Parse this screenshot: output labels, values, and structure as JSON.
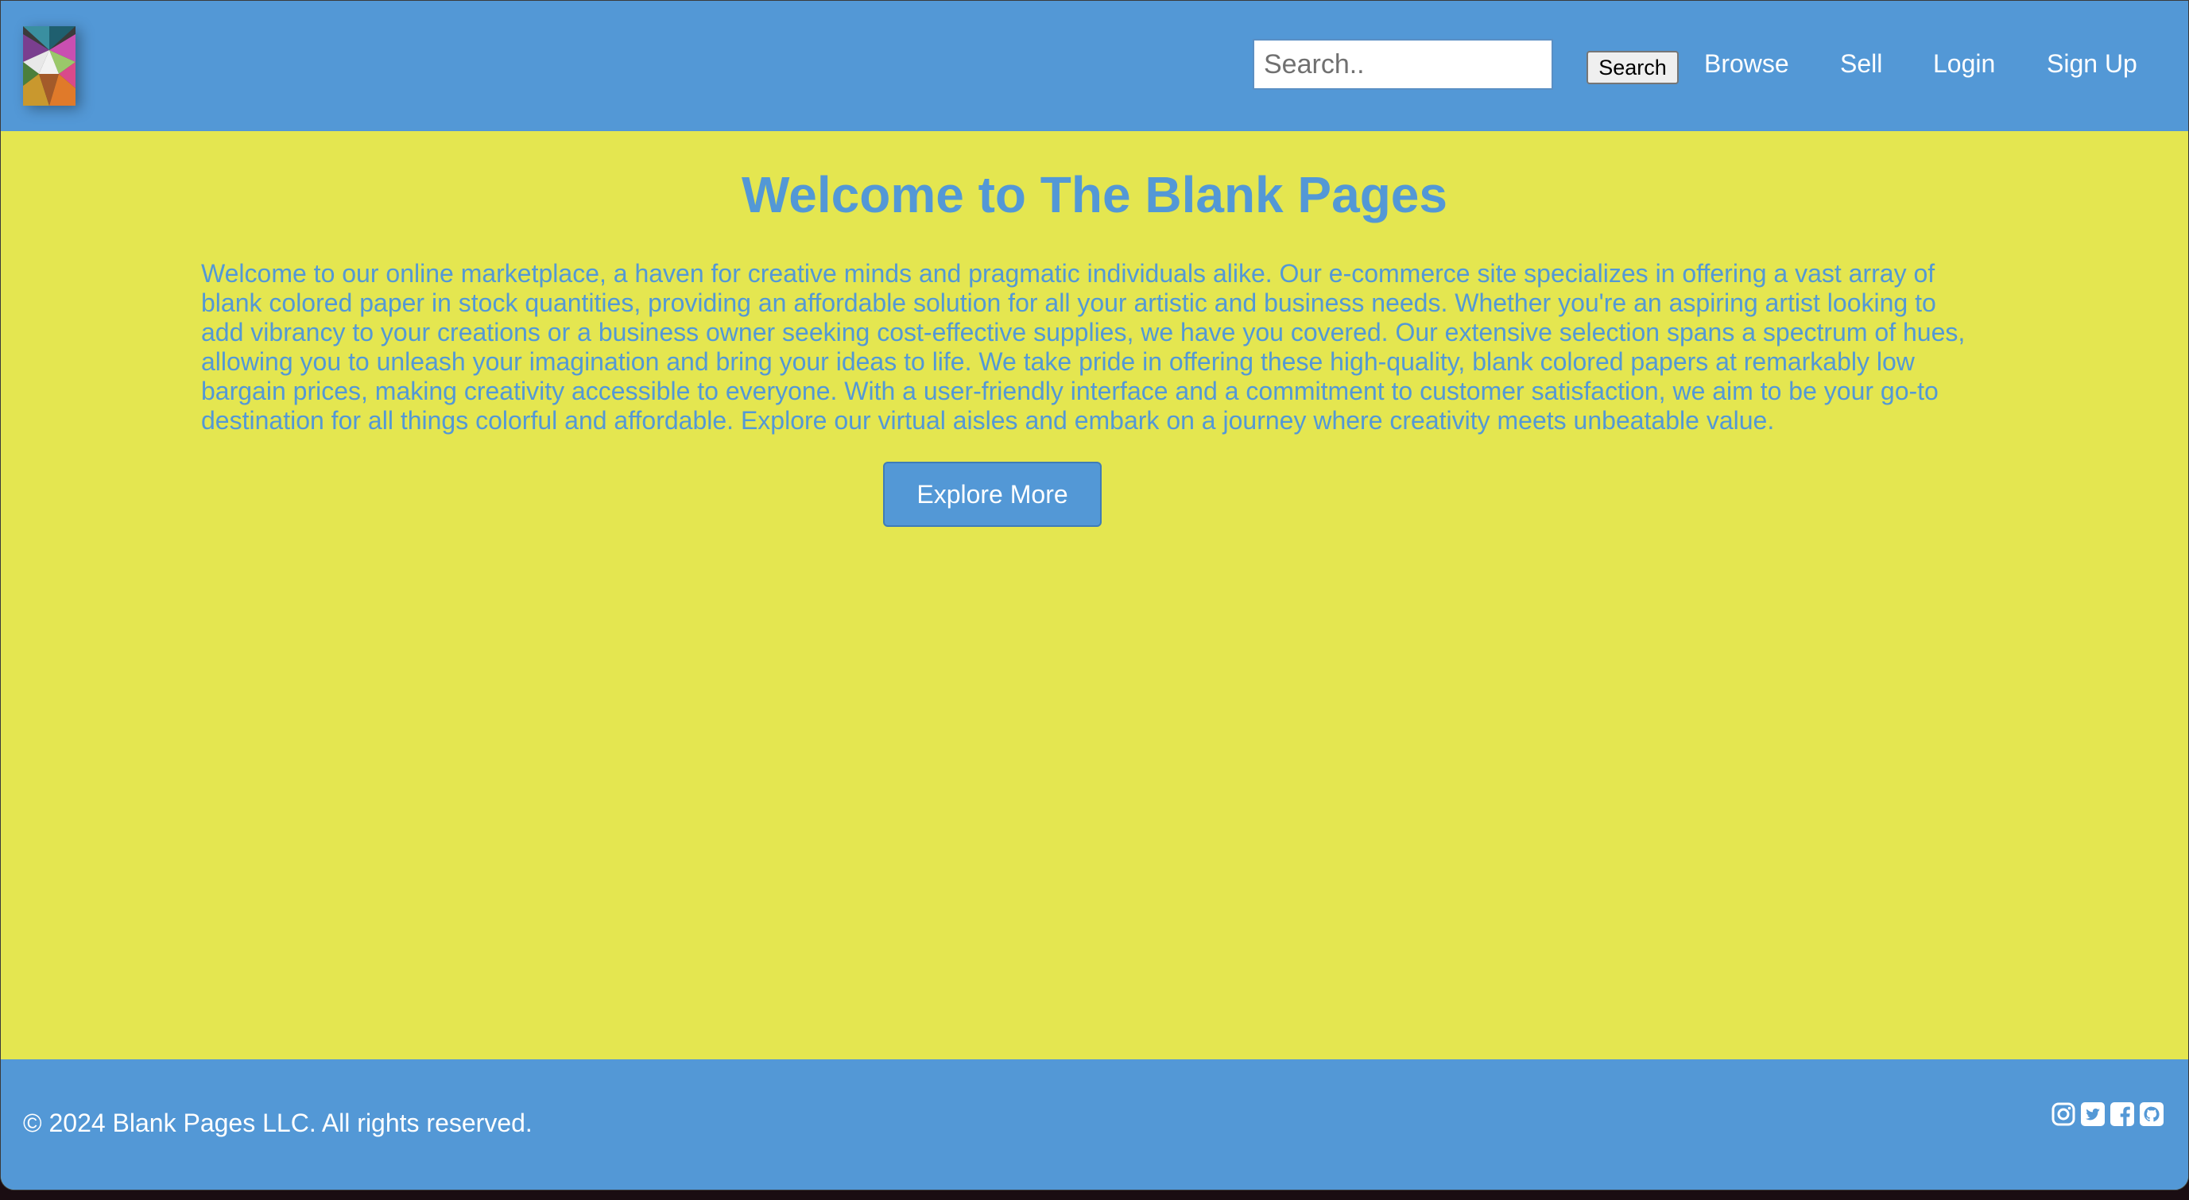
{
  "header": {
    "logo_alt": "Blank Pages logo",
    "search": {
      "placeholder": "Search..",
      "value": "",
      "button_label": "Search"
    },
    "nav": [
      {
        "label": "Browse"
      },
      {
        "label": "Sell"
      },
      {
        "label": "Login"
      },
      {
        "label": "Sign Up"
      }
    ]
  },
  "main": {
    "title": "Welcome to The Blank Pages",
    "intro": "Welcome to our online marketplace, a haven for creative minds and pragmatic individuals alike. Our e-commerce site specializes in offering a vast array of blank colored paper in stock quantities, providing an affordable solution for all your artistic and business needs. Whether you're an aspiring artist looking to add vibrancy to your creations or a business owner seeking cost-effective supplies, we have you covered. Our extensive selection spans a spectrum of hues, allowing you to unleash your imagination and bring your ideas to life. We take pride in offering these high-quality, blank colored papers at remarkably low bargain prices, making creativity accessible to everyone. With a user-friendly interface and a commitment to customer satisfaction, we aim to be your go-to destination for all things colorful and affordable. Explore our virtual aisles and embark on a journey where creativity meets unbeatable value.",
    "explore_button": "Explore More"
  },
  "footer": {
    "copyright": "© 2024 Blank Pages LLC. All rights reserved.",
    "social_icons": [
      "instagram-icon",
      "twitter-icon",
      "facebook-icon",
      "github-icon"
    ]
  },
  "colors": {
    "header_footer": "#5398d6",
    "page_background": "#e4e650",
    "text_accent": "#5398d6"
  }
}
